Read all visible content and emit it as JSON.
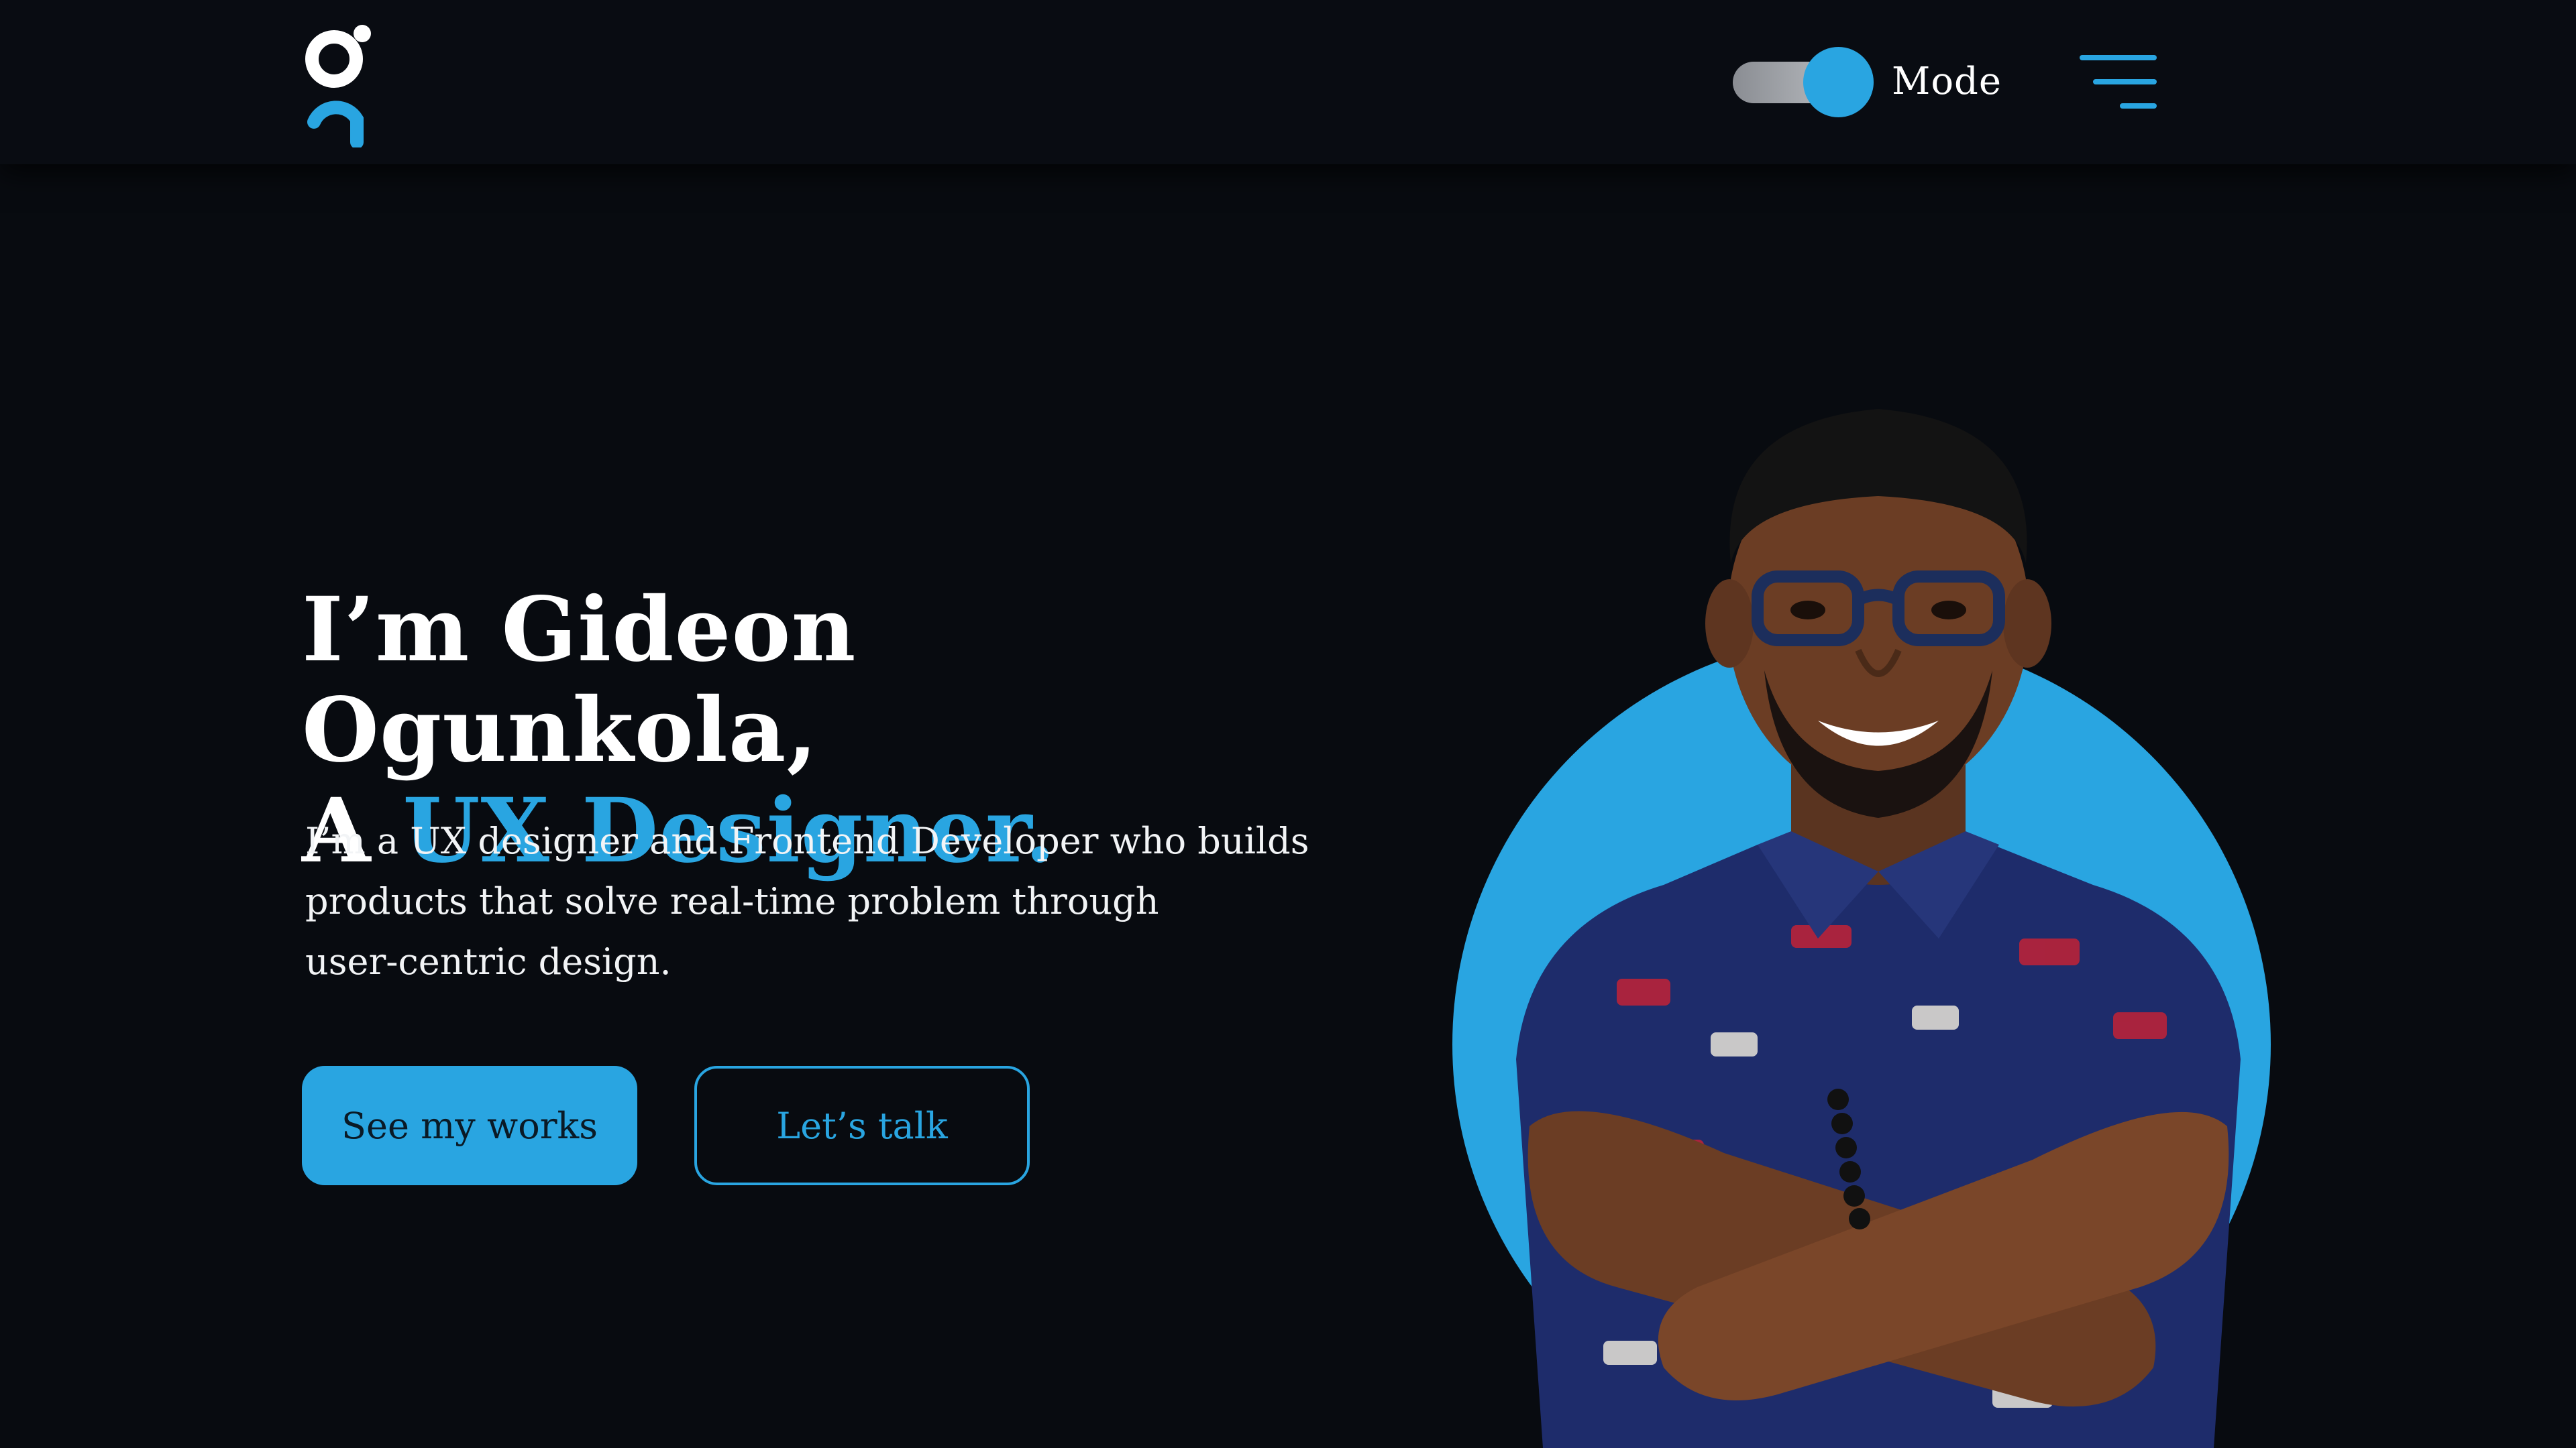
{
  "header": {
    "logo_icon": "g-monogram-logo",
    "mode_toggle": {
      "state": "on",
      "icon": "toggle-switch"
    },
    "mode_label": "Mode",
    "menu_icon": "hamburger-menu-icon"
  },
  "hero": {
    "title_line1": "I’m Gideon Ogunkola,",
    "title_line2_prefix": "A ",
    "title_line2_accent": "UX Designer.",
    "description_line1": "I’m a UX designer and Frontend Developer who builds",
    "description_line2": "products that solve real-time problem through",
    "description_line3": "user-centric design.",
    "primary_button": "See my works",
    "secondary_button": "Let’s talk"
  },
  "colors": {
    "background": "#080b10",
    "accent": "#29a5e1",
    "text": "#ffffff"
  }
}
